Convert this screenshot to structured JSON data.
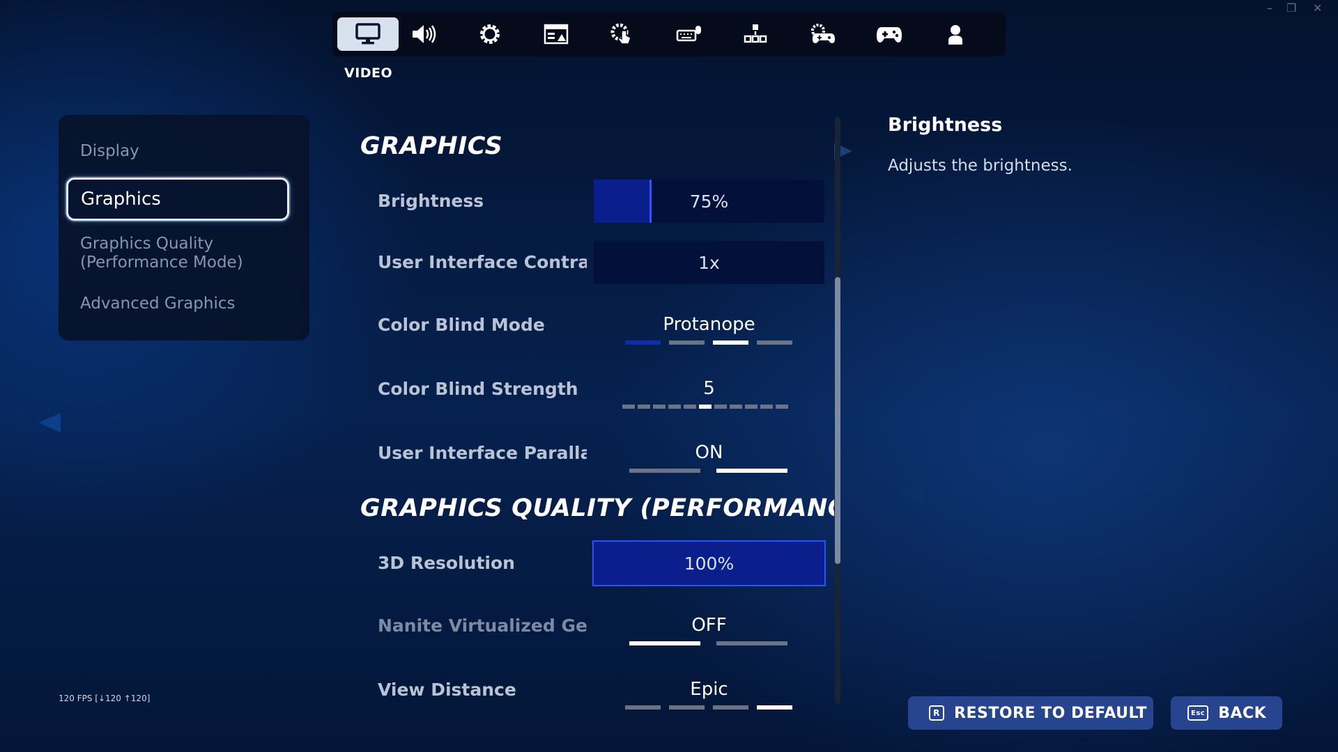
{
  "top_tabs": [
    {
      "icon": "monitor-icon",
      "active": true
    },
    {
      "icon": "speaker-icon"
    },
    {
      "icon": "gear-icon"
    },
    {
      "icon": "hud-layout-icon"
    },
    {
      "icon": "touch-settings-icon"
    },
    {
      "icon": "keyboard-mouse-icon"
    },
    {
      "icon": "button-layout-icon"
    },
    {
      "icon": "controller-settings-icon"
    },
    {
      "icon": "gamepad-icon"
    },
    {
      "icon": "account-icon"
    }
  ],
  "section_label": "VIDEO",
  "sidebar": {
    "items": [
      {
        "label": "Display"
      },
      {
        "label": "Graphics",
        "active": true
      },
      {
        "label": "Graphics Quality\n(Performance Mode)"
      },
      {
        "label": "Advanced Graphics"
      }
    ]
  },
  "graphics": {
    "heading": "GRAPHICS",
    "brightness": {
      "label": "Brightness",
      "value": "75%",
      "fill_fraction": 0.25
    },
    "ui_contrast": {
      "label": "User Interface Contrast",
      "value": "1x"
    },
    "color_blind_mode": {
      "label": "Color Blind Mode",
      "value": "Protanope",
      "options_count": 4,
      "selected_index": 2
    },
    "color_blind_strength": {
      "label": "Color Blind Strength",
      "value": "5",
      "steps": 11,
      "selected_index": 5
    },
    "ui_parallax": {
      "label": "User Interface Parallax",
      "value": "ON",
      "options_count": 2,
      "selected_index": 1
    }
  },
  "quality": {
    "heading": "GRAPHICS QUALITY (PERFORMANCE MODE)",
    "resolution_3d": {
      "label": "3D Resolution",
      "value": "100%",
      "fill_fraction": 1.0
    },
    "nanite": {
      "label": "Nanite Virtualized Geometry",
      "value": "OFF",
      "options_count": 2,
      "selected_index": 0
    },
    "view_distance": {
      "label": "View Distance",
      "value": "Epic",
      "options_count": 4,
      "selected_index": 3
    }
  },
  "description": {
    "title": "Brightness",
    "text": "Adjusts the brightness."
  },
  "fps_counter": "120 FPS [↓120 ↑120]",
  "footer": {
    "restore_key": "R",
    "restore_label": "RESTORE TO DEFAULT",
    "back_key": "Esc",
    "back_label": "BACK"
  },
  "window_controls": {
    "minimize": "–",
    "restore": "❐",
    "close": "✕"
  },
  "colors": {
    "accent_blue": "#0a1f8c",
    "selection_blue": "#2e55ff",
    "footer_button": "#27448f"
  }
}
